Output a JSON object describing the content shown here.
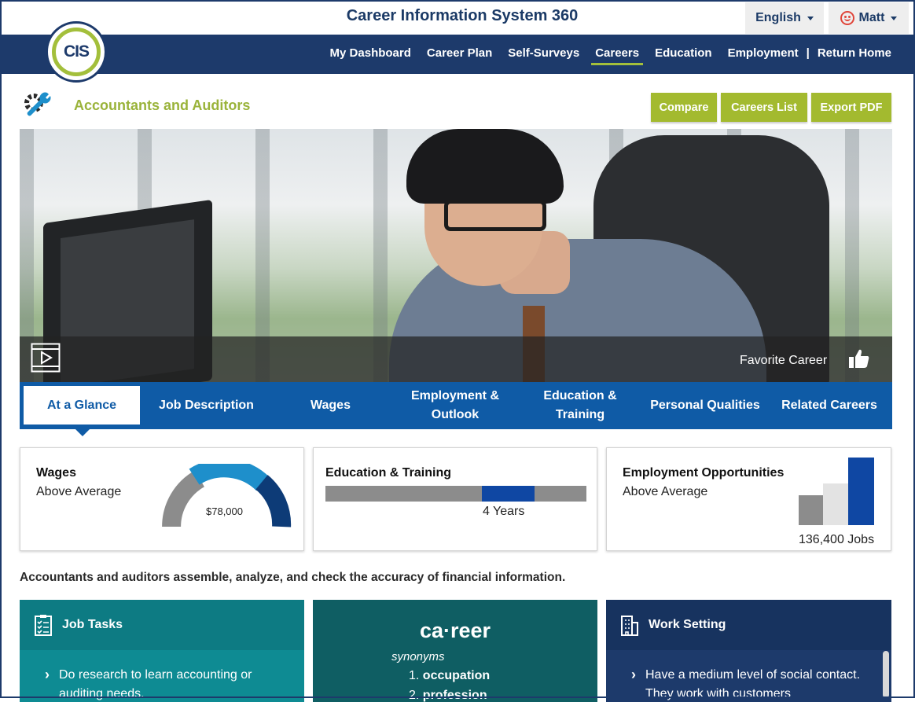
{
  "header": {
    "system_title": "Career Information System 360",
    "language_label": "English",
    "user_label": "Matt",
    "logo_text": "CIS"
  },
  "nav": {
    "items": [
      "My Dashboard",
      "Career Plan",
      "Self-Surveys",
      "Careers",
      "Education",
      "Employment",
      "Return Home"
    ],
    "active": "Careers",
    "separator": "|"
  },
  "page": {
    "title": "Accountants and Auditors",
    "actions": [
      "Compare",
      "Careers List",
      "Export PDF"
    ]
  },
  "hero": {
    "favorite_label": "Favorite Career"
  },
  "tabs": {
    "items": [
      {
        "line1": "At a Glance",
        "line2": ""
      },
      {
        "line1": "Job Description",
        "line2": ""
      },
      {
        "line1": "Wages",
        "line2": ""
      },
      {
        "line1": "Employment &",
        "line2": "Outlook"
      },
      {
        "line1": "Education &",
        "line2": "Training"
      },
      {
        "line1": "Personal Qualities",
        "line2": ""
      },
      {
        "line1": "Related Careers",
        "line2": ""
      }
    ],
    "active": "At a Glance"
  },
  "glance": {
    "wages": {
      "title": "Wages",
      "level": "Above Average",
      "value": "$78,000"
    },
    "education": {
      "title": "Education & Training",
      "value": "4 Years",
      "bar_segment": [
        0.6,
        0.8
      ]
    },
    "employment": {
      "title": "Employment Opportunities",
      "level": "Above Average",
      "value": "136,400 Jobs",
      "bar_levels": [
        0.44,
        0.62,
        1.0
      ]
    }
  },
  "summary": "Accountants and auditors assemble, analyze, and check the accuracy of financial information.",
  "panels": {
    "job_tasks": {
      "title": "Job Tasks",
      "item": "Do research to learn accounting or auditing needs."
    },
    "dictionary": {
      "word": "ca·reer",
      "synonyms_label": "synonyms",
      "list": [
        {
          "num": "1.",
          "word": "occupation"
        },
        {
          "num": "2.",
          "word": "profession"
        }
      ]
    },
    "work_setting": {
      "title": "Work Setting",
      "item": "Have a medium level of social contact. They work with customers"
    }
  },
  "colors": {
    "navy": "#1d3a6b",
    "tab_blue": "#0f5ba6",
    "lime": "#a3ba2f",
    "teal": "#0e8b93",
    "dark_teal": "#0f5e63",
    "gauge_blue": "#1e8fcb",
    "gauge_navy": "#0d3b77"
  }
}
